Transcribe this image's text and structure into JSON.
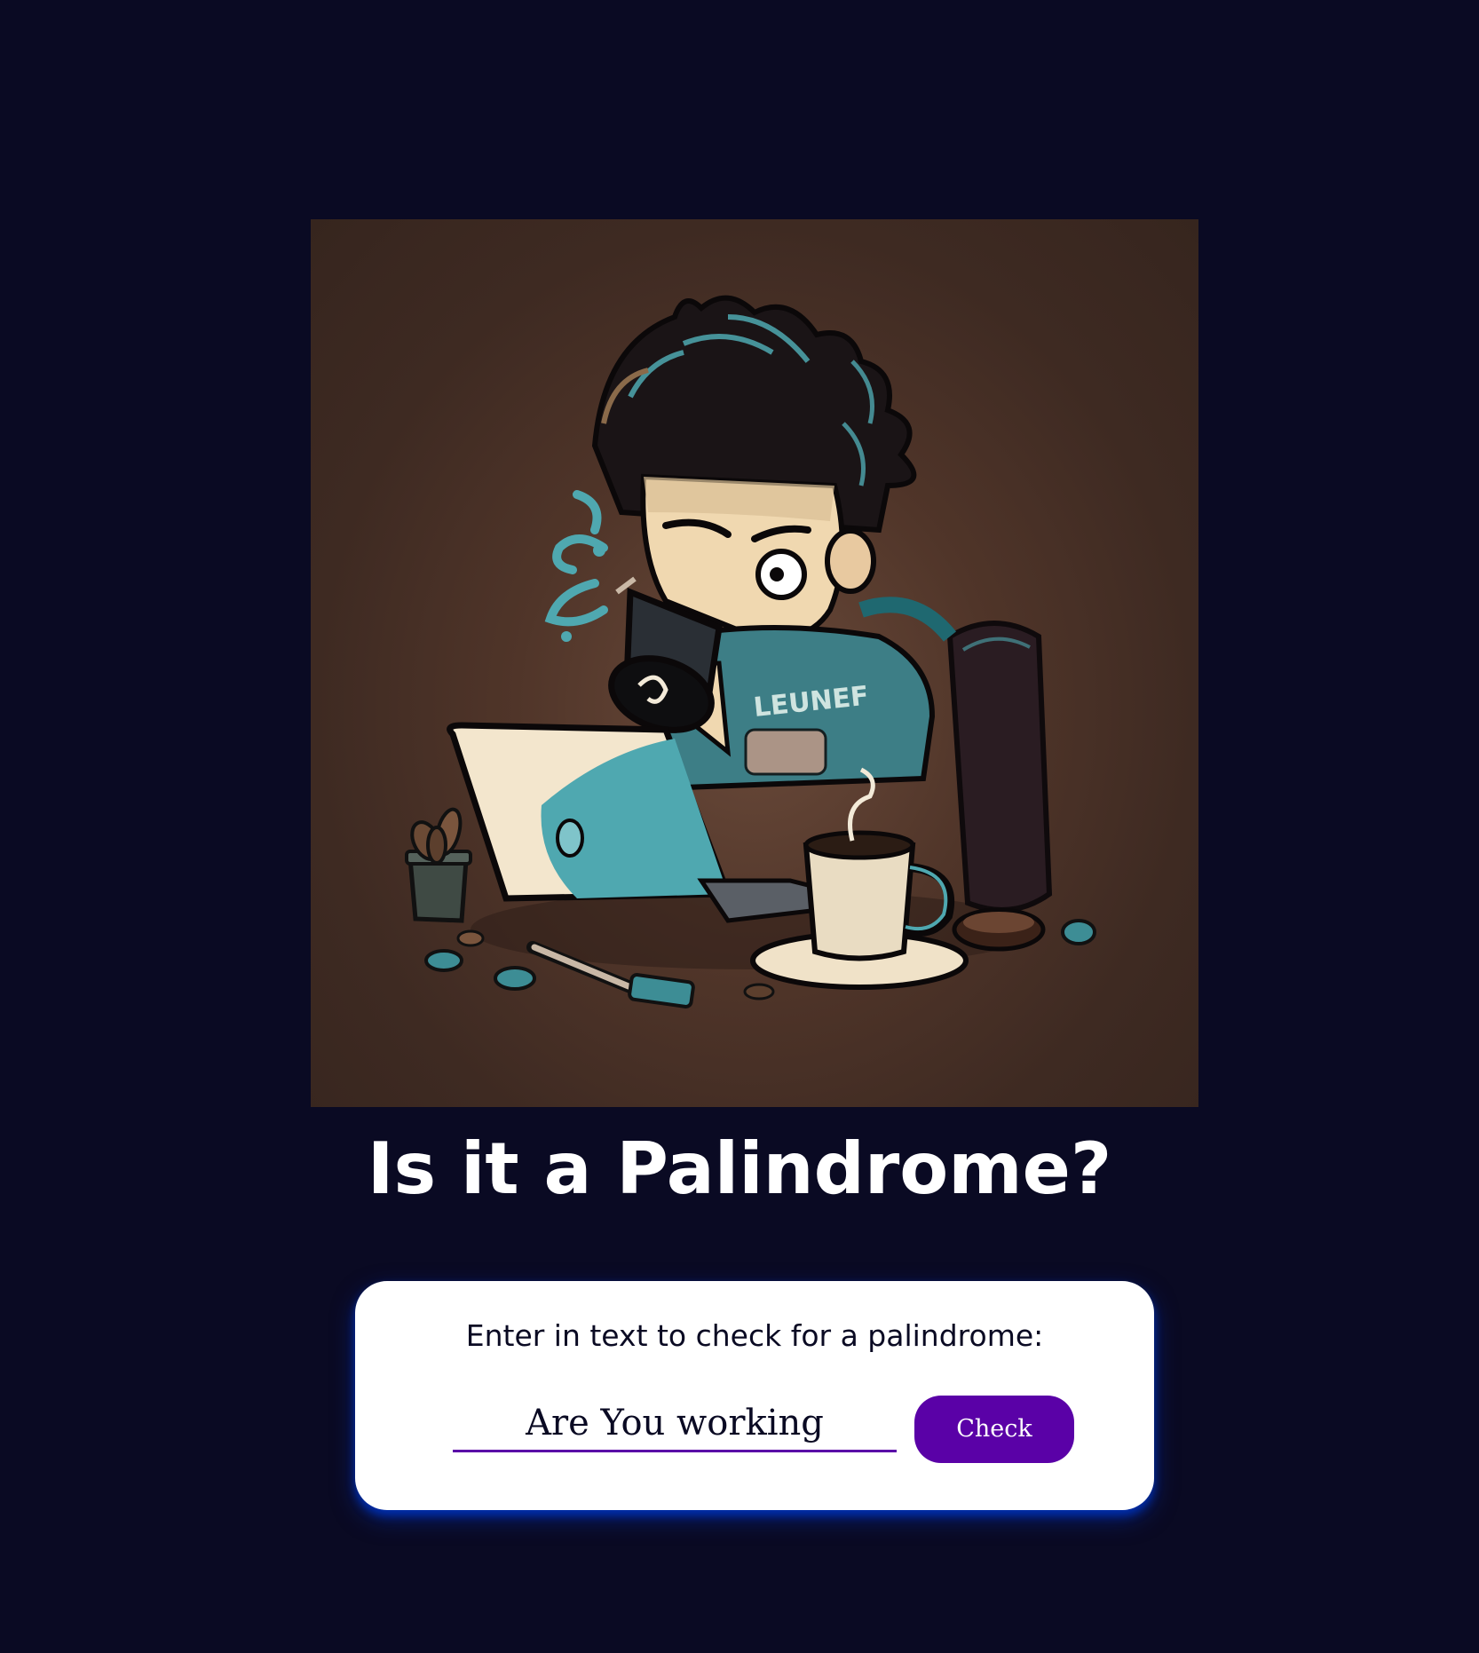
{
  "hero_image": {
    "alt": "",
    "depicts": "cartoon developer sipping coffee at a laptop"
  },
  "page": {
    "title": "Is it a Palindrome?"
  },
  "form": {
    "label": "Enter in text to check for a palindrome:",
    "input_value": "Are You working",
    "input_placeholder": "",
    "check_label": "Check"
  },
  "colors": {
    "background": "#0a0a23",
    "card": "#ffffff",
    "accent": "#5a01a7",
    "card_shadow": "#002ead",
    "text_dark": "#0a0a23",
    "text_light": "#ffffff",
    "illustration_teal": "#4fa8b0"
  }
}
